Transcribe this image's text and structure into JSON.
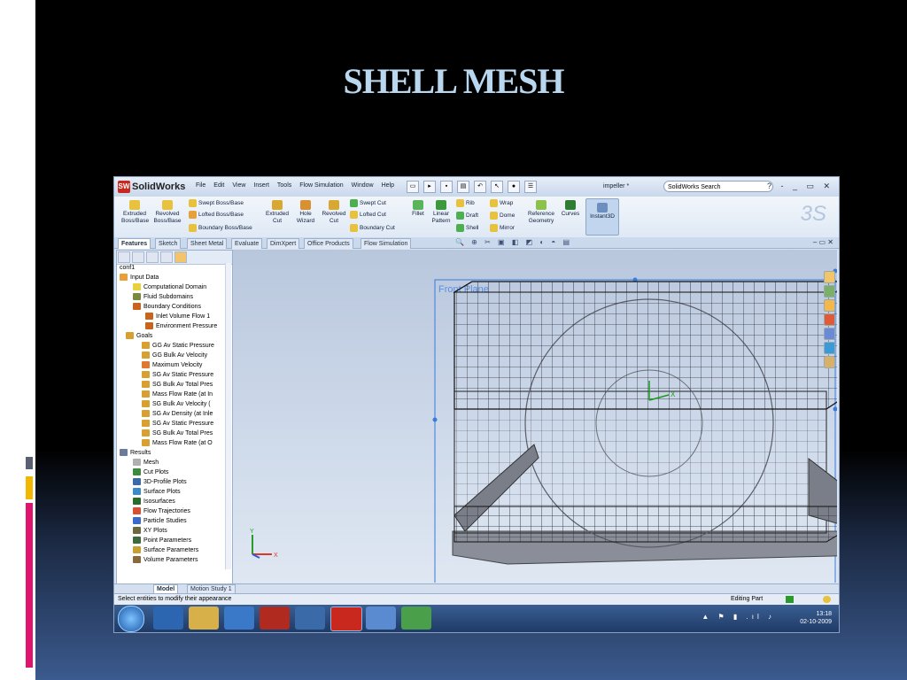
{
  "slide": {
    "title": "SHELL MESH",
    "accent_colors": [
      "#5a6070",
      "#f2b800",
      "#e0136e"
    ]
  },
  "app": {
    "name": "SolidWorks",
    "menu": [
      "File",
      "Edit",
      "View",
      "Insert",
      "Tools",
      "Flow Simulation",
      "Window",
      "Help"
    ],
    "document_title": "impeller *",
    "search_placeholder": "SolidWorks Search",
    "window_controls": "? - _ ▭ ✕"
  },
  "ribbon": {
    "extruded_boss": "Extruded Boss/Base",
    "revolved_boss": "Revolved Boss/Base",
    "swept_boss": "Swept Boss/Base",
    "lofted_boss": "Lofted Boss/Base",
    "boundary_boss": "Boundary Boss/Base",
    "extruded_cut": "Extruded Cut",
    "hole_wizard": "Hole Wizard",
    "revolved_cut": "Revolved Cut",
    "swept_cut": "Swept Cut",
    "lofted_cut": "Lofted Cut",
    "boundary_cut": "Boundary Cut",
    "fillet": "Fillet",
    "linear_pattern": "Linear Pattern",
    "rib": "Rib",
    "draft": "Draft",
    "shell": "Shell",
    "wrap": "Wrap",
    "dome": "Dome",
    "mirror": "Mirror",
    "reference_geometry": "Reference Geometry",
    "curves": "Curves",
    "instant3d": "Instant3D"
  },
  "tabs": [
    "Features",
    "Sketch",
    "Sheet Metal",
    "Evaluate",
    "DimXpert",
    "Office Products",
    "Flow Simulation"
  ],
  "tree": {
    "config": "conf1",
    "items": [
      "Input Data",
      "Computational Domain",
      "Fluid Subdomains",
      "Boundary Conditions",
      "Inlet Volume Flow 1",
      "Environment Pressure",
      "Goals",
      "GG Av Static Pressure",
      "GG Bulk Av Velocity",
      "Maximum Velocity",
      "SG Av Static Pressure",
      "SG Bulk Av Total Pres",
      "Mass Flow Rate (at In",
      "SG Bulk Av Velocity (",
      "SG Av Density (at Inle",
      "SG Av Static Pressure",
      "SG Bulk Av Total Pres",
      "Mass Flow Rate (at O",
      "Results",
      "Mesh",
      "Cut Plots",
      "3D-Profile Plots",
      "Surface Plots",
      "Isosurfaces",
      "Flow Trajectories",
      "Particle Studies",
      "XY Plots",
      "Point Parameters",
      "Surface Parameters",
      "Volume Parameters"
    ]
  },
  "viewport": {
    "plane_label": "Front Plane",
    "axis_x": "X",
    "axis_y": "Y"
  },
  "bottom_tabs": [
    "Model",
    "Motion Study 1"
  ],
  "status": {
    "message": "Select entities to modify their appearance",
    "mode": "Editing Part"
  },
  "taskbar": {
    "time": "13:18",
    "date": "02-10-2009"
  }
}
